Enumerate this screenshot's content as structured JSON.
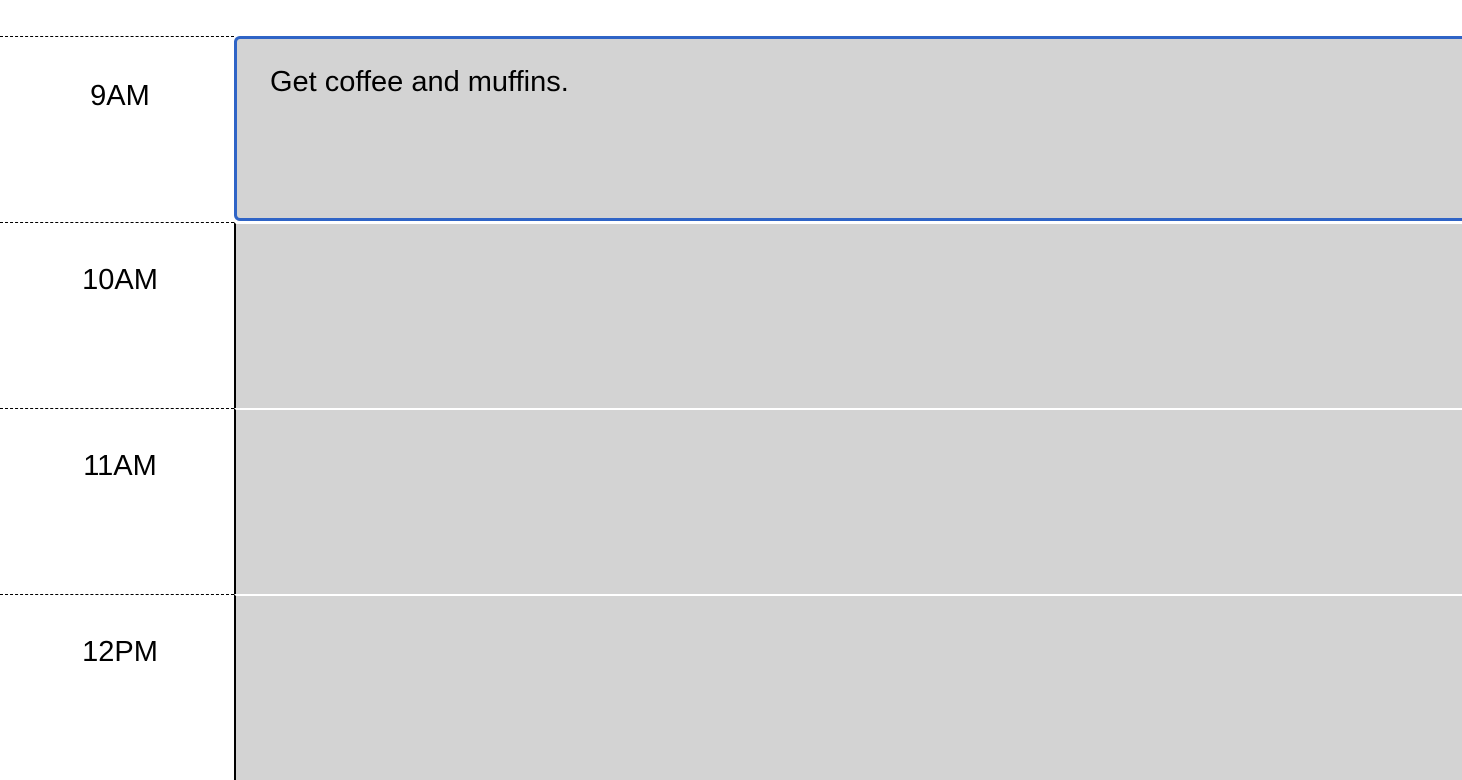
{
  "schedule": {
    "rows": [
      {
        "hour": "9AM",
        "event": "Get coffee and muffins.",
        "focused": true
      },
      {
        "hour": "10AM",
        "event": ""
      },
      {
        "hour": "11AM",
        "event": ""
      },
      {
        "hour": "12PM",
        "event": ""
      }
    ]
  },
  "colors": {
    "slot_background": "#d3d3d3",
    "focus_border": "#2f64c6"
  }
}
